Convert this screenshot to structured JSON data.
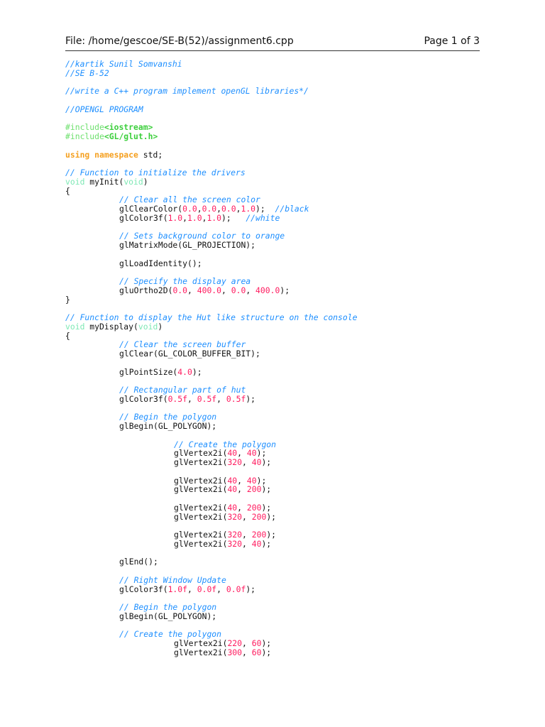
{
  "header": {
    "file": "File: /home/gescoe/SE-B(52)/assignment6.cpp",
    "page": "Page 1 of 3"
  },
  "colors": {
    "comment": "#1e8fff",
    "preprocessor": "#6ee06e",
    "keyword": "#f5a020",
    "type": "#7de8b4",
    "number": "#ff1a5e"
  },
  "code": {
    "lines": [
      {
        "indent": 0,
        "segs": [
          [
            "c",
            "//kartik Sunil Somvanshi"
          ]
        ]
      },
      {
        "indent": 0,
        "segs": [
          [
            "c",
            "//SE B-52"
          ]
        ]
      },
      {
        "indent": 0,
        "segs": []
      },
      {
        "indent": 0,
        "segs": [
          [
            "c",
            "//write a C++ program implement openGL libraries*/"
          ]
        ]
      },
      {
        "indent": 0,
        "segs": []
      },
      {
        "indent": 0,
        "segs": [
          [
            "c",
            "//OPENGL PROGRAM"
          ]
        ]
      },
      {
        "indent": 0,
        "segs": []
      },
      {
        "indent": 0,
        "segs": [
          [
            "p",
            "#include"
          ],
          [
            "ps",
            "<iostream>"
          ]
        ]
      },
      {
        "indent": 0,
        "segs": [
          [
            "p",
            "#include"
          ],
          [
            "ps",
            "<GL/glut.h>"
          ]
        ]
      },
      {
        "indent": 0,
        "segs": []
      },
      {
        "indent": 0,
        "segs": [
          [
            "k",
            "using"
          ],
          [
            "x",
            " "
          ],
          [
            "k",
            "namespace"
          ],
          [
            "x",
            " std;"
          ]
        ]
      },
      {
        "indent": 0,
        "segs": []
      },
      {
        "indent": 0,
        "segs": [
          [
            "c",
            "// Function to initialize the drivers"
          ]
        ]
      },
      {
        "indent": 0,
        "segs": [
          [
            "t",
            "void"
          ],
          [
            "x",
            " myInit("
          ],
          [
            "t",
            "void"
          ],
          [
            "x",
            ")"
          ]
        ]
      },
      {
        "indent": 0,
        "segs": [
          [
            "x",
            "{"
          ]
        ]
      },
      {
        "indent": 1,
        "segs": [
          [
            "c",
            "// Clear all the screen color"
          ]
        ]
      },
      {
        "indent": 1,
        "segs": [
          [
            "x",
            "glClearColor("
          ],
          [
            "n",
            "0.0"
          ],
          [
            "x",
            ","
          ],
          [
            "n",
            "0.0"
          ],
          [
            "x",
            ","
          ],
          [
            "n",
            "0.0"
          ],
          [
            "x",
            ","
          ],
          [
            "n",
            "1.0"
          ],
          [
            "x",
            ");  "
          ],
          [
            "c",
            "//black"
          ]
        ]
      },
      {
        "indent": 1,
        "segs": [
          [
            "x",
            "glColor3f("
          ],
          [
            "n",
            "1.0"
          ],
          [
            "x",
            ","
          ],
          [
            "n",
            "1.0"
          ],
          [
            "x",
            ","
          ],
          [
            "n",
            "1.0"
          ],
          [
            "x",
            ");   "
          ],
          [
            "c",
            "//white"
          ]
        ]
      },
      {
        "indent": 1,
        "segs": []
      },
      {
        "indent": 1,
        "segs": [
          [
            "c",
            "// Sets background color to orange"
          ]
        ]
      },
      {
        "indent": 1,
        "segs": [
          [
            "x",
            "glMatrixMode(GL_PROJECTION);"
          ]
        ]
      },
      {
        "indent": 1,
        "segs": []
      },
      {
        "indent": 1,
        "segs": [
          [
            "x",
            "glLoadIdentity();"
          ]
        ]
      },
      {
        "indent": 1,
        "segs": []
      },
      {
        "indent": 1,
        "segs": [
          [
            "c",
            "// Specify the display area"
          ]
        ]
      },
      {
        "indent": 1,
        "segs": [
          [
            "x",
            "gluOrtho2D("
          ],
          [
            "n",
            "0.0"
          ],
          [
            "x",
            ", "
          ],
          [
            "n",
            "400.0"
          ],
          [
            "x",
            ", "
          ],
          [
            "n",
            "0.0"
          ],
          [
            "x",
            ", "
          ],
          [
            "n",
            "400.0"
          ],
          [
            "x",
            ");"
          ]
        ]
      },
      {
        "indent": 0,
        "segs": [
          [
            "x",
            "}"
          ]
        ]
      },
      {
        "indent": 0,
        "segs": []
      },
      {
        "indent": 0,
        "segs": [
          [
            "c",
            "// Function to display the Hut like structure on the console"
          ]
        ]
      },
      {
        "indent": 0,
        "segs": [
          [
            "t",
            "void"
          ],
          [
            "x",
            " myDisplay("
          ],
          [
            "t",
            "void"
          ],
          [
            "x",
            ")"
          ]
        ]
      },
      {
        "indent": 0,
        "segs": [
          [
            "x",
            "{"
          ]
        ]
      },
      {
        "indent": 1,
        "segs": [
          [
            "c",
            "// Clear the screen buffer"
          ]
        ]
      },
      {
        "indent": 1,
        "segs": [
          [
            "x",
            "glClear(GL_COLOR_BUFFER_BIT);"
          ]
        ]
      },
      {
        "indent": 1,
        "segs": []
      },
      {
        "indent": 1,
        "segs": [
          [
            "x",
            "glPointSize("
          ],
          [
            "n",
            "4.0"
          ],
          [
            "x",
            ");"
          ]
        ]
      },
      {
        "indent": 1,
        "segs": []
      },
      {
        "indent": 1,
        "segs": [
          [
            "c",
            "// Rectangular part of hut"
          ]
        ]
      },
      {
        "indent": 1,
        "segs": [
          [
            "x",
            "glColor3f("
          ],
          [
            "n",
            "0.5f"
          ],
          [
            "x",
            ", "
          ],
          [
            "n",
            "0.5f"
          ],
          [
            "x",
            ", "
          ],
          [
            "n",
            "0.5f"
          ],
          [
            "x",
            ");"
          ]
        ]
      },
      {
        "indent": 1,
        "segs": []
      },
      {
        "indent": 1,
        "segs": [
          [
            "c",
            "// Begin the polygon"
          ]
        ]
      },
      {
        "indent": 1,
        "segs": [
          [
            "x",
            "glBegin(GL_POLYGON);"
          ]
        ]
      },
      {
        "indent": 1,
        "segs": []
      },
      {
        "indent": 2,
        "segs": [
          [
            "c",
            "// Create the polygon"
          ]
        ]
      },
      {
        "indent": 2,
        "segs": [
          [
            "x",
            "glVertex2i("
          ],
          [
            "n",
            "40"
          ],
          [
            "x",
            ", "
          ],
          [
            "n",
            "40"
          ],
          [
            "x",
            ");"
          ]
        ]
      },
      {
        "indent": 2,
        "segs": [
          [
            "x",
            "glVertex2i("
          ],
          [
            "n",
            "320"
          ],
          [
            "x",
            ", "
          ],
          [
            "n",
            "40"
          ],
          [
            "x",
            ");"
          ]
        ]
      },
      {
        "indent": 2,
        "segs": []
      },
      {
        "indent": 2,
        "segs": [
          [
            "x",
            "glVertex2i("
          ],
          [
            "n",
            "40"
          ],
          [
            "x",
            ", "
          ],
          [
            "n",
            "40"
          ],
          [
            "x",
            ");"
          ]
        ]
      },
      {
        "indent": 2,
        "segs": [
          [
            "x",
            "glVertex2i("
          ],
          [
            "n",
            "40"
          ],
          [
            "x",
            ", "
          ],
          [
            "n",
            "200"
          ],
          [
            "x",
            ");"
          ]
        ]
      },
      {
        "indent": 2,
        "segs": []
      },
      {
        "indent": 2,
        "segs": [
          [
            "x",
            "glVertex2i("
          ],
          [
            "n",
            "40"
          ],
          [
            "x",
            ", "
          ],
          [
            "n",
            "200"
          ],
          [
            "x",
            ");"
          ]
        ]
      },
      {
        "indent": 2,
        "segs": [
          [
            "x",
            "glVertex2i("
          ],
          [
            "n",
            "320"
          ],
          [
            "x",
            ", "
          ],
          [
            "n",
            "200"
          ],
          [
            "x",
            ");"
          ]
        ]
      },
      {
        "indent": 2,
        "segs": []
      },
      {
        "indent": 2,
        "segs": [
          [
            "x",
            "glVertex2i("
          ],
          [
            "n",
            "320"
          ],
          [
            "x",
            ", "
          ],
          [
            "n",
            "200"
          ],
          [
            "x",
            ");"
          ]
        ]
      },
      {
        "indent": 2,
        "segs": [
          [
            "x",
            "glVertex2i("
          ],
          [
            "n",
            "320"
          ],
          [
            "x",
            ", "
          ],
          [
            "n",
            "40"
          ],
          [
            "x",
            ");"
          ]
        ]
      },
      {
        "indent": 2,
        "segs": []
      },
      {
        "indent": 1,
        "segs": [
          [
            "x",
            "glEnd();"
          ]
        ]
      },
      {
        "indent": 1,
        "segs": []
      },
      {
        "indent": 1,
        "segs": [
          [
            "c",
            "// Right Window Update"
          ]
        ]
      },
      {
        "indent": 1,
        "segs": [
          [
            "x",
            "glColor3f("
          ],
          [
            "n",
            "1.0f"
          ],
          [
            "x",
            ", "
          ],
          [
            "n",
            "0.0f"
          ],
          [
            "x",
            ", "
          ],
          [
            "n",
            "0.0f"
          ],
          [
            "x",
            ");"
          ]
        ]
      },
      {
        "indent": 1,
        "segs": []
      },
      {
        "indent": 1,
        "segs": [
          [
            "c",
            "// Begin the polygon"
          ]
        ]
      },
      {
        "indent": 1,
        "segs": [
          [
            "x",
            "glBegin(GL_POLYGON);"
          ]
        ]
      },
      {
        "indent": 1,
        "segs": []
      },
      {
        "indent": 1,
        "segs": [
          [
            "c",
            "// Create the polygon"
          ]
        ]
      },
      {
        "indent": 2,
        "segs": [
          [
            "x",
            "glVertex2i("
          ],
          [
            "n",
            "220"
          ],
          [
            "x",
            ", "
          ],
          [
            "n",
            "60"
          ],
          [
            "x",
            ");"
          ]
        ]
      },
      {
        "indent": 2,
        "segs": [
          [
            "x",
            "glVertex2i("
          ],
          [
            "n",
            "300"
          ],
          [
            "x",
            ", "
          ],
          [
            "n",
            "60"
          ],
          [
            "x",
            ");"
          ]
        ]
      }
    ]
  }
}
